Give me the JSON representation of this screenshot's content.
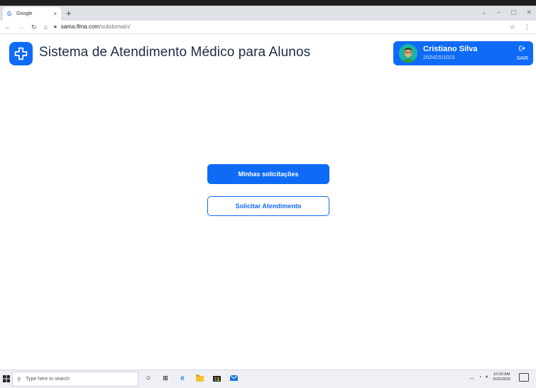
{
  "browser": {
    "tab_title": "Google",
    "tab_favicon": "G",
    "tab_close": "×",
    "new_tab": "+",
    "window_controls": [
      "⌄",
      "–",
      "▢",
      "✕"
    ],
    "url_host": "sama.ifma.com",
    "url_path": "/subdomain/"
  },
  "app": {
    "title": "Sistema de Atendimento Médico para Alunos",
    "brand_color": "#0f6bf5"
  },
  "user": {
    "name": "Cristiano Silva",
    "id": "20242SI1023",
    "logout_label": "SAIR"
  },
  "actions": {
    "primary_label": "Minhas solicitações",
    "secondary_label": "Solicitar Atendimento"
  },
  "taskbar": {
    "search_placeholder": "Type here to search",
    "time": "10:00 AM",
    "date": "9/20/2020"
  }
}
